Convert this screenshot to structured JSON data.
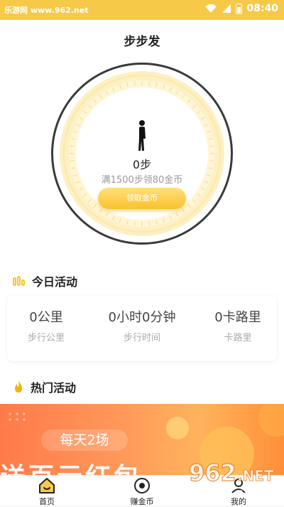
{
  "status_bar": {
    "left_text": "乐游网 www.962.net",
    "time": "08:40",
    "icons": [
      "wifi-icon",
      "signal-icon",
      "battery-icon"
    ]
  },
  "header": {
    "title": "步步发"
  },
  "pedometer": {
    "steps": "0步",
    "goal": "满1500步领80金币",
    "claim_button": "领取金币",
    "progress_fraction": 0
  },
  "today": {
    "title": "今日活动",
    "stats": [
      {
        "value": "0公里",
        "label": "步行公里"
      },
      {
        "value": "0小时0分钟",
        "label": "步行时间"
      },
      {
        "value": "0卡路里",
        "label": "卡路里"
      }
    ]
  },
  "hot": {
    "title": "热门活动",
    "banner_line1": "每天2场",
    "banner_line2": "送百元红包"
  },
  "tabbar": {
    "tabs": [
      {
        "label": "首页",
        "icon": "home-icon"
      },
      {
        "label": "赚金币",
        "icon": "earn-coins-icon"
      },
      {
        "label": "我的",
        "icon": "profile-icon"
      }
    ]
  },
  "watermark": {
    "brand": "962.NET",
    "sub": "乐游网"
  },
  "colors": {
    "accent": "#f7c948",
    "banner": "#ff8a4f"
  }
}
